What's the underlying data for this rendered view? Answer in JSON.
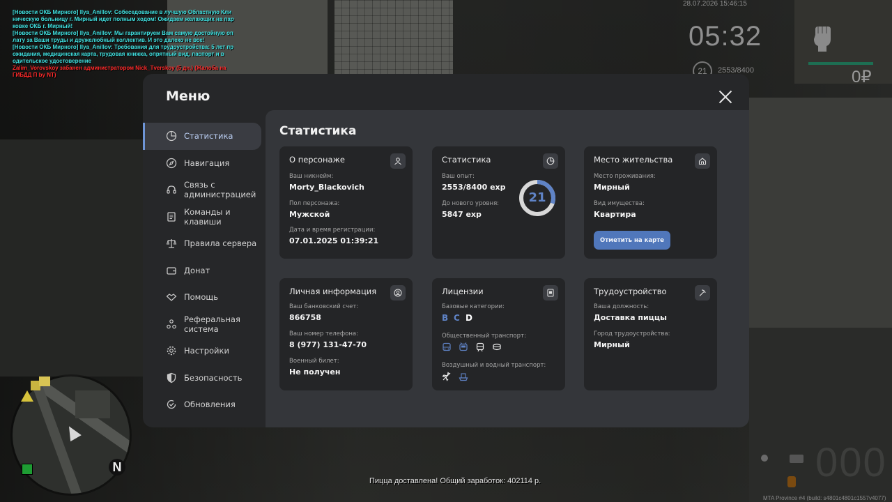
{
  "chat": [
    {
      "type": "news",
      "text": "[Новости ОКБ Мирного] Ilya_Anillov: Собеседование в лучшую Областную Кли"
    },
    {
      "type": "news",
      "text": "ническую больницу г. Мирный идет полным ходом! Ожидаем желающих на пар"
    },
    {
      "type": "news",
      "text": "ковке ОКБ г. Мирный!"
    },
    {
      "type": "news",
      "text": "[Новости ОКБ Мирного] Ilya_Anillov: Мы гарантируем Вам самую достойную оп"
    },
    {
      "type": "news",
      "text": "лату за Ваши труды и дружелюбный коллектив. И это далеко не все!"
    },
    {
      "type": "news",
      "text": "[Новости ОКБ Мирного] Ilya_Anillov: Требования для трудоустройства: 5 лет пр"
    },
    {
      "type": "news",
      "text": "ожидания, медицинская карта, трудовая книжка, опрятный вид, паспорт и в"
    },
    {
      "type": "news",
      "text": "одительское удостоверение"
    },
    {
      "type": "admin",
      "text": "Zalim_Vorovskoy забанен администратором Nick_Tverskoy (5 дн.) (Жалоба на"
    },
    {
      "type": "admin",
      "text": " ГИБДД П by NT)"
    }
  ],
  "hud": {
    "date": "28.07.2026 15:46:15",
    "time": "05:32",
    "level": "21",
    "exp": "2553/8400",
    "money": "0₽",
    "north": "N",
    "speed": "000"
  },
  "bottom_message": "Пицца доставлена! Общий заработок: 402114 р.",
  "build": "MTA Province #4 (build: s4801c4801c1557v4077)",
  "menu": {
    "title": "Меню",
    "nav": [
      {
        "label": "Статистика",
        "icon": "pie-chart-icon",
        "active": true
      },
      {
        "label": "Навигация",
        "icon": "compass-icon"
      },
      {
        "label": "Связь с администрацией",
        "icon": "headset-icon"
      },
      {
        "label": "Команды и клавиши",
        "icon": "document-icon"
      },
      {
        "label": "Правила сервера",
        "icon": "scales-icon"
      },
      {
        "label": "Донат",
        "icon": "wallet-icon"
      },
      {
        "label": "Помощь",
        "icon": "handshake-icon"
      },
      {
        "label": "Реферальная система",
        "icon": "referral-icon"
      },
      {
        "label": "Настройки",
        "icon": "gear-icon"
      },
      {
        "label": "Безопасность",
        "icon": "shield-icon"
      },
      {
        "label": "Обновления",
        "icon": "update-icon"
      }
    ],
    "content_title": "Статистика",
    "character": {
      "title": "О персонаже",
      "nick_label": "Ваш никнейм:",
      "nick": "Morty_Blackovich",
      "gender_label": "Пол персонажа:",
      "gender": "Мужской",
      "reg_label": "Дата и время регистрации:",
      "reg": "07.01.2025 01:39:21"
    },
    "stats": {
      "title": "Статистика",
      "exp_label": "Ваш опыт:",
      "exp": "2553/8400 exp",
      "next_label": "До нового уровня:",
      "next": "5847 exp",
      "level": "21",
      "progress": 0.304
    },
    "residence": {
      "title": "Место жительства",
      "place_label": "Место проживания:",
      "place": "Мирный",
      "type_label": "Вид имущества:",
      "type": "Квартира",
      "button": "Отметить на карте"
    },
    "personal": {
      "title": "Личная информация",
      "bank_label": "Ваш банковский счет:",
      "bank": "866758",
      "phone_label": "Ваш номер телефона:",
      "phone": "8 (977) 131-47-70",
      "military_label": "Военный билет:",
      "military": "Не получен"
    },
    "licenses": {
      "title": "Лицензии",
      "base_label": "Базовые категории:",
      "categories": [
        "B",
        "C",
        "D"
      ],
      "public_label": "Общественный транспорт:",
      "air_label": "Воздушный и водный транспорт:"
    },
    "employment": {
      "title": "Трудоустройство",
      "position_label": "Ваша должность:",
      "position": "Доставка пиццы",
      "city_label": "Город трудоустройства:",
      "city": "Мирный"
    }
  },
  "colors": {
    "accent": "#5077bb",
    "ring": "#5f83c6",
    "cat_active": "#5f83c6",
    "cat_inactive": "#ffffff"
  }
}
